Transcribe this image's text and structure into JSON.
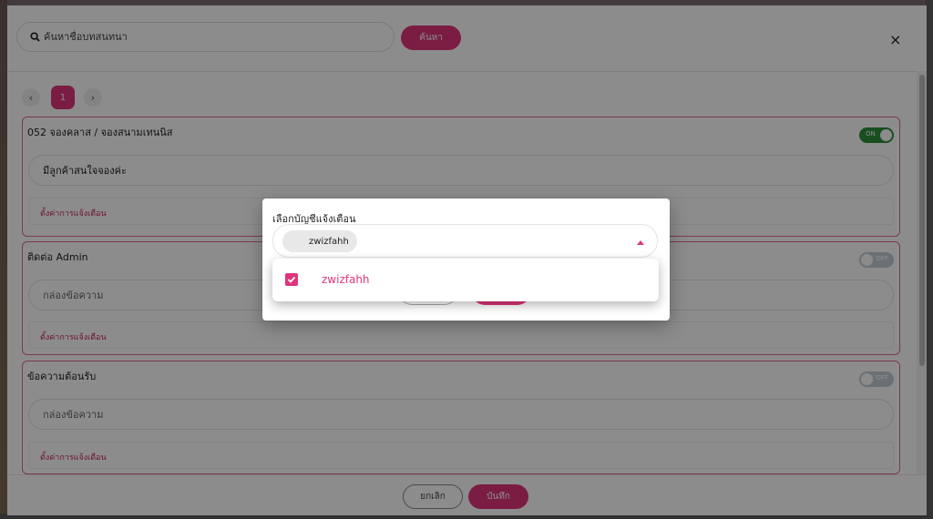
{
  "search": {
    "placeholder": "ค้นหาชื่อบทสนทนา",
    "button_label": "ค้นหา"
  },
  "close_label": "×",
  "pagination": {
    "prev": "‹",
    "current": "1",
    "next": "›"
  },
  "cards": [
    {
      "title": "052 จองคลาส / จองสนามเทนนิส",
      "toggle": "ON",
      "message": "มีลูกค้าสนใจจองค่ะ",
      "notify_link": "ตั้งค่าการแจ้งเตือน"
    },
    {
      "title": "ติดต่อ Admin",
      "toggle": "OFF",
      "message_placeholder": "กล่องข้อความ",
      "notify_link": "ตั้งค่าการแจ้งเตือน"
    },
    {
      "title": "ข้อความต้อนรับ",
      "toggle": "OFF",
      "message_placeholder": "กล่องข้อความ",
      "notify_link": "ตั้งค่าการแจ้งเตือน"
    }
  ],
  "footer": {
    "cancel_label": "ยกเลิก",
    "save_label": "บันทึก"
  },
  "dialog": {
    "label": "เลือกบัญชีแจ้งเตือน",
    "selected_chip": "zwizfahh",
    "options": [
      {
        "label": "zwizfahh",
        "checked": true
      }
    ]
  },
  "colors": {
    "accent": "#e0357b",
    "toggle_on": "#2f8f3a",
    "toggle_off": "#c4ccd6"
  }
}
